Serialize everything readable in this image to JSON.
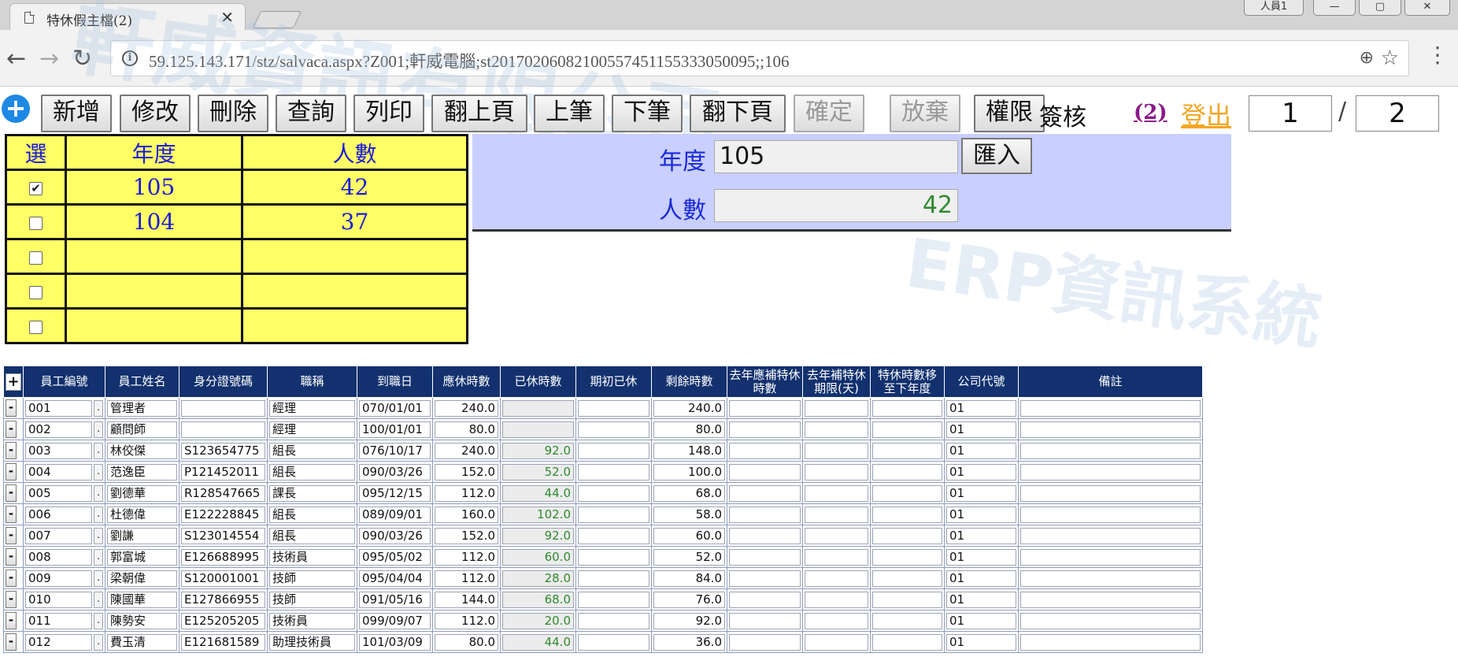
{
  "browser": {
    "tab_title": "特休假主檔(2)",
    "tab_close": "✕",
    "user_label": "人員1",
    "url": "59.125.143.171/stz/salvaca.aspx?Z001;軒威電腦;st20170206082100557451155333050095;;106"
  },
  "watermark": {
    "line1": "軒威資訊有限公司",
    "line2": "ERP資訊系統"
  },
  "toolbar": {
    "buttons": [
      "新增",
      "修改",
      "刪除",
      "查詢",
      "列印",
      "翻上頁",
      "上筆",
      "下筆",
      "翻下頁",
      "確定",
      "放棄",
      "權限"
    ],
    "sign_label": "簽核",
    "sign_count": "(2)",
    "logout": "登出",
    "page_current": "1",
    "page_separator": "/",
    "page_total": "2"
  },
  "year_table": {
    "headers": [
      "選",
      "年度",
      "人數"
    ],
    "rows": [
      {
        "checked": true,
        "year": "105",
        "count": "42"
      },
      {
        "checked": false,
        "year": "104",
        "count": "37"
      },
      {
        "checked": false,
        "year": "",
        "count": ""
      },
      {
        "checked": false,
        "year": "",
        "count": ""
      },
      {
        "checked": false,
        "year": "",
        "count": ""
      }
    ]
  },
  "detail": {
    "year_label": "年度",
    "year_value": "105",
    "import_button": "匯入",
    "count_label": "人數",
    "count_value": "42"
  },
  "grid": {
    "add_row": "+",
    "delete_row": "-",
    "headers": [
      "員工編號",
      "員工姓名",
      "身分證號碼",
      "職稱",
      "到職日",
      "應休時數",
      "已休時數",
      "期初已休",
      "剩餘時數",
      "去年應補特休時數",
      "去年補特休期限(天)",
      "特休時數移至下年度",
      "公司代號",
      "備註"
    ],
    "rows": [
      [
        "001",
        "管理者",
        "",
        "經理",
        "070/01/01",
        "240.0",
        "",
        "",
        "240.0",
        "",
        "",
        "",
        "01",
        ""
      ],
      [
        "002",
        "顧問師",
        "",
        "經理",
        "100/01/01",
        "80.0",
        "",
        "",
        "80.0",
        "",
        "",
        "",
        "01",
        ""
      ],
      [
        "003",
        "林佼傑",
        "S123654775",
        "組長",
        "076/10/17",
        "240.0",
        "92.0",
        "",
        "148.0",
        "",
        "",
        "",
        "01",
        ""
      ],
      [
        "004",
        "范逸臣",
        "P121452011",
        "組長",
        "090/03/26",
        "152.0",
        "52.0",
        "",
        "100.0",
        "",
        "",
        "",
        "01",
        ""
      ],
      [
        "005",
        "劉德華",
        "R128547665",
        "課長",
        "095/12/15",
        "112.0",
        "44.0",
        "",
        "68.0",
        "",
        "",
        "",
        "01",
        ""
      ],
      [
        "006",
        "杜德偉",
        "E122228845",
        "組長",
        "089/09/01",
        "160.0",
        "102.0",
        "",
        "58.0",
        "",
        "",
        "",
        "01",
        ""
      ],
      [
        "007",
        "劉謙",
        "S123014554",
        "組長",
        "090/03/26",
        "152.0",
        "92.0",
        "",
        "60.0",
        "",
        "",
        "",
        "01",
        ""
      ],
      [
        "008",
        "郭富城",
        "E126688995",
        "技術員",
        "095/05/02",
        "112.0",
        "60.0",
        "",
        "52.0",
        "",
        "",
        "",
        "01",
        ""
      ],
      [
        "009",
        "梁朝偉",
        "S120001001",
        "技師",
        "095/04/04",
        "112.0",
        "28.0",
        "",
        "84.0",
        "",
        "",
        "",
        "01",
        ""
      ],
      [
        "010",
        "陳國華",
        "E127866955",
        "技師",
        "091/05/16",
        "144.0",
        "68.0",
        "",
        "76.0",
        "",
        "",
        "",
        "01",
        ""
      ],
      [
        "011",
        "陳勢安",
        "E125205205",
        "技術員",
        "099/09/07",
        "112.0",
        "20.0",
        "",
        "92.0",
        "",
        "",
        "",
        "01",
        ""
      ],
      [
        "012",
        "費玉清",
        "E121681589",
        "助理技術員",
        "101/03/09",
        "80.0",
        "44.0",
        "",
        "36.0",
        "",
        "",
        "",
        "01",
        ""
      ]
    ]
  },
  "colors": {
    "header_bg": "#12316e",
    "year_table_bg": "#ffff66",
    "panel_bg": "#c9cfff",
    "used_hours_text": "#2f8a2f",
    "logout": "#f5a623"
  }
}
